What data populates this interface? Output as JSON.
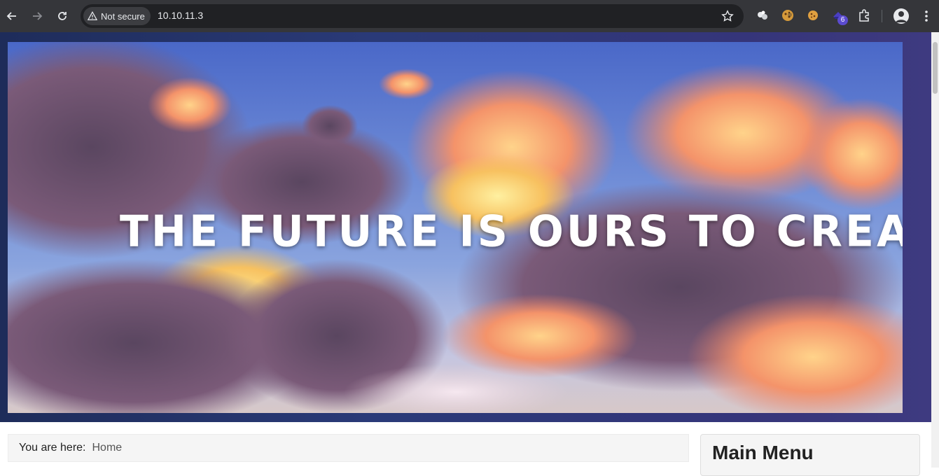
{
  "browser": {
    "security_label": "Not secure",
    "url": "10.10.11.3",
    "extension_badge": "6"
  },
  "hero": {
    "headline": "THE FUTURE IS OURS TO CREATE."
  },
  "breadcrumb": {
    "prefix": "You are here:",
    "current": "Home"
  },
  "sidebar": {
    "menu_title": "Main Menu"
  }
}
